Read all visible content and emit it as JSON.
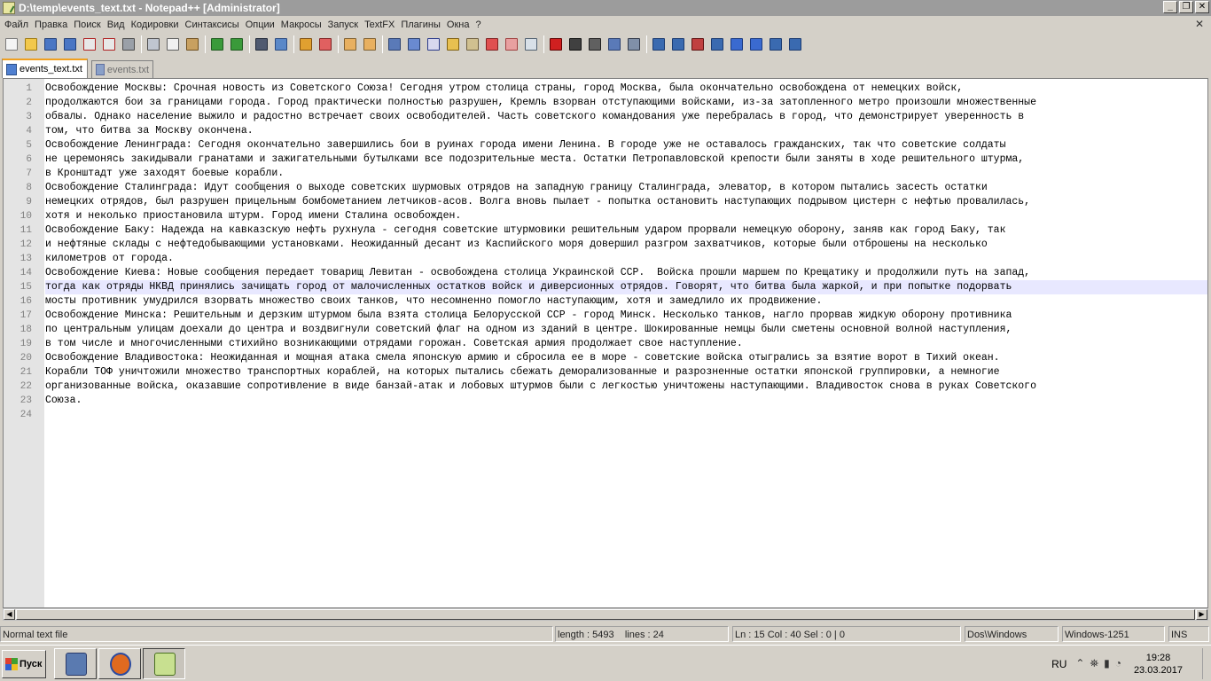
{
  "window": {
    "title": "D:\\temp\\events_text.txt - Notepad++ [Administrator]",
    "controls": [
      "_",
      "❐",
      "✕"
    ]
  },
  "menu": {
    "items": [
      "Файл",
      "Правка",
      "Поиск",
      "Вид",
      "Кодировки",
      "Синтаксисы",
      "Опции",
      "Макросы",
      "Запуск",
      "TextFX",
      "Плагины",
      "Окна",
      "?"
    ],
    "close_doc": "✕"
  },
  "toolbar": {
    "icons": [
      {
        "name": "new-file-icon",
        "color": "#f4f4f4",
        "border": "#7a7a7a"
      },
      {
        "name": "open-file-icon",
        "color": "#f2c84b",
        "border": "#a07a10"
      },
      {
        "name": "save-icon",
        "color": "#4a76c4",
        "border": "#22407a"
      },
      {
        "name": "save-all-icon",
        "color": "#4a76c4",
        "border": "#22407a"
      },
      {
        "name": "close-file-icon",
        "color": "#e8e8e8",
        "border": "#b02020"
      },
      {
        "name": "close-all-icon",
        "color": "#e8e8e8",
        "border": "#b02020"
      },
      {
        "name": "print-icon",
        "color": "#9aa0a8",
        "border": "#4a4a4a"
      },
      "sep",
      {
        "name": "cut-icon",
        "color": "#c0c6d0",
        "border": "#505050"
      },
      {
        "name": "copy-icon",
        "color": "#f0f0f0",
        "border": "#606060"
      },
      {
        "name": "paste-icon",
        "color": "#c8a060",
        "border": "#705020"
      },
      "sep",
      {
        "name": "undo-icon",
        "color": "#3a9a3a",
        "border": "#1e5a1e"
      },
      {
        "name": "redo-icon",
        "color": "#3a9a3a",
        "border": "#1e5a1e"
      },
      "sep",
      {
        "name": "find-icon",
        "color": "#505a70",
        "border": "#202838"
      },
      {
        "name": "replace-icon",
        "color": "#5a88c8",
        "border": "#2a4a80"
      },
      "sep",
      {
        "name": "zoom-in-icon",
        "color": "#e0a030",
        "border": "#805010"
      },
      {
        "name": "zoom-out-icon",
        "color": "#e06060",
        "border": "#802020"
      },
      "sep",
      {
        "name": "sync-vertical-icon",
        "color": "#e8b060",
        "border": "#806030"
      },
      {
        "name": "sync-horizontal-icon",
        "color": "#e8b060",
        "border": "#806030"
      },
      "sep",
      {
        "name": "word-wrap-icon",
        "color": "#5a7ab8",
        "border": "#2a4070"
      },
      {
        "name": "show-all-chars-icon",
        "color": "#6a8ad0",
        "border": "#2a4070"
      },
      {
        "name": "indent-guide-icon",
        "color": "#d8d8ee",
        "border": "#2a3a8a"
      },
      {
        "name": "udl-icon",
        "color": "#e8c050",
        "border": "#806010"
      },
      {
        "name": "doc-map-icon",
        "color": "#d0c090",
        "border": "#706040"
      },
      {
        "name": "function-list-icon",
        "color": "#e05050",
        "border": "#802020"
      },
      {
        "name": "folder-workspace-icon",
        "color": "#e8a0a0",
        "border": "#a04040"
      },
      {
        "name": "monitoring-icon",
        "color": "#d8e0e8",
        "border": "#506070"
      },
      "sep",
      {
        "name": "record-macro-icon",
        "color": "#d02020",
        "border": "#600000"
      },
      {
        "name": "stop-record-icon",
        "color": "#404040",
        "border": "#101010"
      },
      {
        "name": "playback-macro-icon",
        "color": "#606060",
        "border": "#202020"
      },
      {
        "name": "run-macro-multiple-icon",
        "color": "#5a7ab8",
        "border": "#2a4070"
      },
      {
        "name": "save-macro-icon",
        "color": "#8090a8",
        "border": "#303848"
      },
      "sep",
      {
        "name": "plugin-1-icon",
        "color": "#3a6ab0",
        "border": "#1a3a70"
      },
      {
        "name": "plugin-2-icon",
        "color": "#3a6ab0",
        "border": "#1a3a70"
      },
      {
        "name": "plugin-3-icon",
        "color": "#c04040",
        "border": "#601010"
      },
      {
        "name": "plugin-4-icon",
        "color": "#3a6ab0",
        "border": "#1a3a70"
      },
      {
        "name": "arrow-up-icon",
        "color": "#3a6ad0",
        "border": "#1a3a80"
      },
      {
        "name": "arrow-down-icon",
        "color": "#3a6ad0",
        "border": "#1a3a80"
      },
      {
        "name": "plugin-5-icon",
        "color": "#3a6ab0",
        "border": "#1a3a70"
      },
      {
        "name": "plugin-6-icon",
        "color": "#3a6ab0",
        "border": "#1a3a70"
      }
    ]
  },
  "tabs": [
    {
      "label": "events_text.txt",
      "active": true
    },
    {
      "label": "events.txt",
      "active": false
    }
  ],
  "editor": {
    "current_line": 15,
    "lines": [
      "Освобождение Москвы: Срочная новость из Советского Союза! Сегодня утром столица страны, город Москва, была окончательно освобождена от немецких войск,",
      "продолжаются бои за границами города. Город практически полностью разрушен, Кремль взорван отступающими войсками, из-за затопленного метро произошли множественные",
      "обвалы. Однако население выжило и радостно встречает своих освободителей. Часть советского командования уже перебралась в город, что демонстрирует уверенность в",
      "том, что битва за Москву окончена.",
      "Освобождение Ленинграда: Сегодня окончательно завершились бои в руинах города имени Ленина. В городе уже не оставалось гражданских, так что советские солдаты",
      "не церемонясь закидывали гранатами и зажигательными бутылками все подозрительные места. Остатки Петропавловской крепости были заняты в ходе решительного штурма,",
      "в Кронштадт уже заходят боевые корабли.",
      "Освобождение Сталинграда: Идут сообщения о выходе советских шурмовых отрядов на западную границу Сталинграда, элеватор, в котором пытались засесть остатки",
      "немецких отрядов, был разрушен прицельным бомбометанием летчиков-асов. Волга вновь пылает - попытка остановить наступающих подрывом цистерн с нефтью провалилась,",
      "хотя и неколько приостановила штурм. Город имени Сталина освобожден.",
      "Освобождение Баку: Надежда на кавказскую нефть рухнула - сегодня советские штурмовики решительным ударом прорвали немецкую оборону, заняв как город Баку, так",
      "и нефтяные склады с нефтедобывающими установками. Неожиданный десант из Каспийского моря довершил разгром захватчиков, которые были отброшены на несколько",
      "километров от города.",
      "Освобождение Киева: Новые сообщения передает товарищ Левитан - освобождена столица Украинской ССР.  Войска прошли маршем по Крещатику и продолжили путь на запад,",
      "тогда как отряды НКВД принялись зачищать город от малочисленных остатков войск и диверсионных отрядов. Говорят, что битва была жаркой, и при попытке подорвать",
      "мосты противник умудрился взорвать множество своих танков, что несомненно помогло наступающим, хотя и замедлило их продвижение.",
      "Освобождение Минска: Решительным и дерзким штурмом была взята столица Белорусской ССР - город Минск. Несколько танков, нагло прорвав жидкую оборону противника",
      "по центральным улицам доехали до центра и воздвигнули советский флаг на одном из зданий в центре. Шокированные немцы были сметены основной волной наступления,",
      "в том числе и многочисленными стихийно возникающими отрядами горожан. Советская армия продолжает свое наступление.",
      "Освобождение Владивостока: Неожиданная и мощная атака смела японскую армию и сбросила ее в море - советские войска отыгрались за взятие ворот в Тихий океан.",
      "Корабли ТОФ уничтожили множество транспортных кораблей, на которых пытались сбежать деморализованные и разрозненные остатки японской группировки, а немногие",
      "организованные войска, оказавшие сопротивление в виде банзай-атак и лобовых штурмов были с легкостью уничтожены наступающими. Владивосток снова в руках Советского",
      "Союза.",
      ""
    ]
  },
  "statusbar": {
    "file_type": "Normal text file",
    "length": "length : 5493",
    "lines": "lines : 24",
    "position": "Ln : 15    Col : 40    Sel : 0 | 0",
    "eol": "Dos\\Windows",
    "encoding": "Windows-1251",
    "mode": "INS"
  },
  "taskbar": {
    "start_label": "Пуск",
    "apps": [
      {
        "name": "taskbar-app-explorer",
        "color": "#5a7ab0",
        "pressed": false
      },
      {
        "name": "taskbar-app-firefox",
        "color": "#e06a20",
        "pressed": false
      },
      {
        "name": "taskbar-app-notepadpp",
        "color": "#8ac040",
        "pressed": true
      }
    ],
    "language": "RU",
    "tray_icons": [
      "⌃",
      "⛯",
      "▮",
      "◔"
    ],
    "time": "19:28",
    "date": "23.03.2017"
  }
}
